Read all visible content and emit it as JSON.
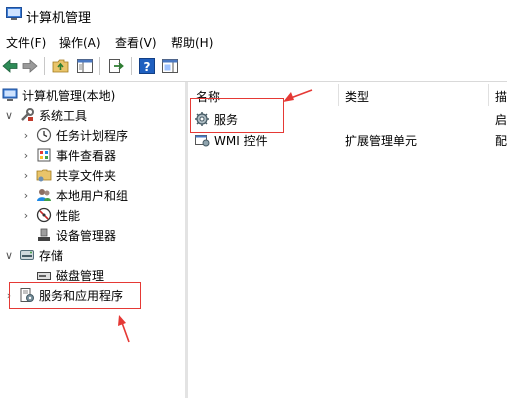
{
  "window": {
    "title": "计算机管理"
  },
  "menu": [
    "文件(F)",
    "操作(A)",
    "查看(V)",
    "帮助(H)"
  ],
  "toolbar_icons": [
    "back-icon",
    "forward-icon",
    "up-folder-icon",
    "show-hide-tree-icon",
    "export-icon",
    "help-icon",
    "properties-icon"
  ],
  "tree": {
    "root": "计算机管理(本地)",
    "system_tools": "系统工具",
    "task_scheduler": "任务计划程序",
    "event_viewer": "事件查看器",
    "shared_folders": "共享文件夹",
    "local_users": "本地用户和组",
    "performance": "性能",
    "device_manager": "设备管理器",
    "storage": "存储",
    "disk_management": "磁盘管理",
    "services_apps": "服务和应用程序"
  },
  "list": {
    "columns": [
      "名称",
      "类型",
      "描"
    ],
    "rows": [
      {
        "name": "服务",
        "type": "",
        "desc": "启"
      },
      {
        "name": "WMI 控件",
        "type": "扩展管理单元",
        "desc": "配"
      }
    ]
  },
  "colors": {
    "highlight_box": "#e53935"
  }
}
